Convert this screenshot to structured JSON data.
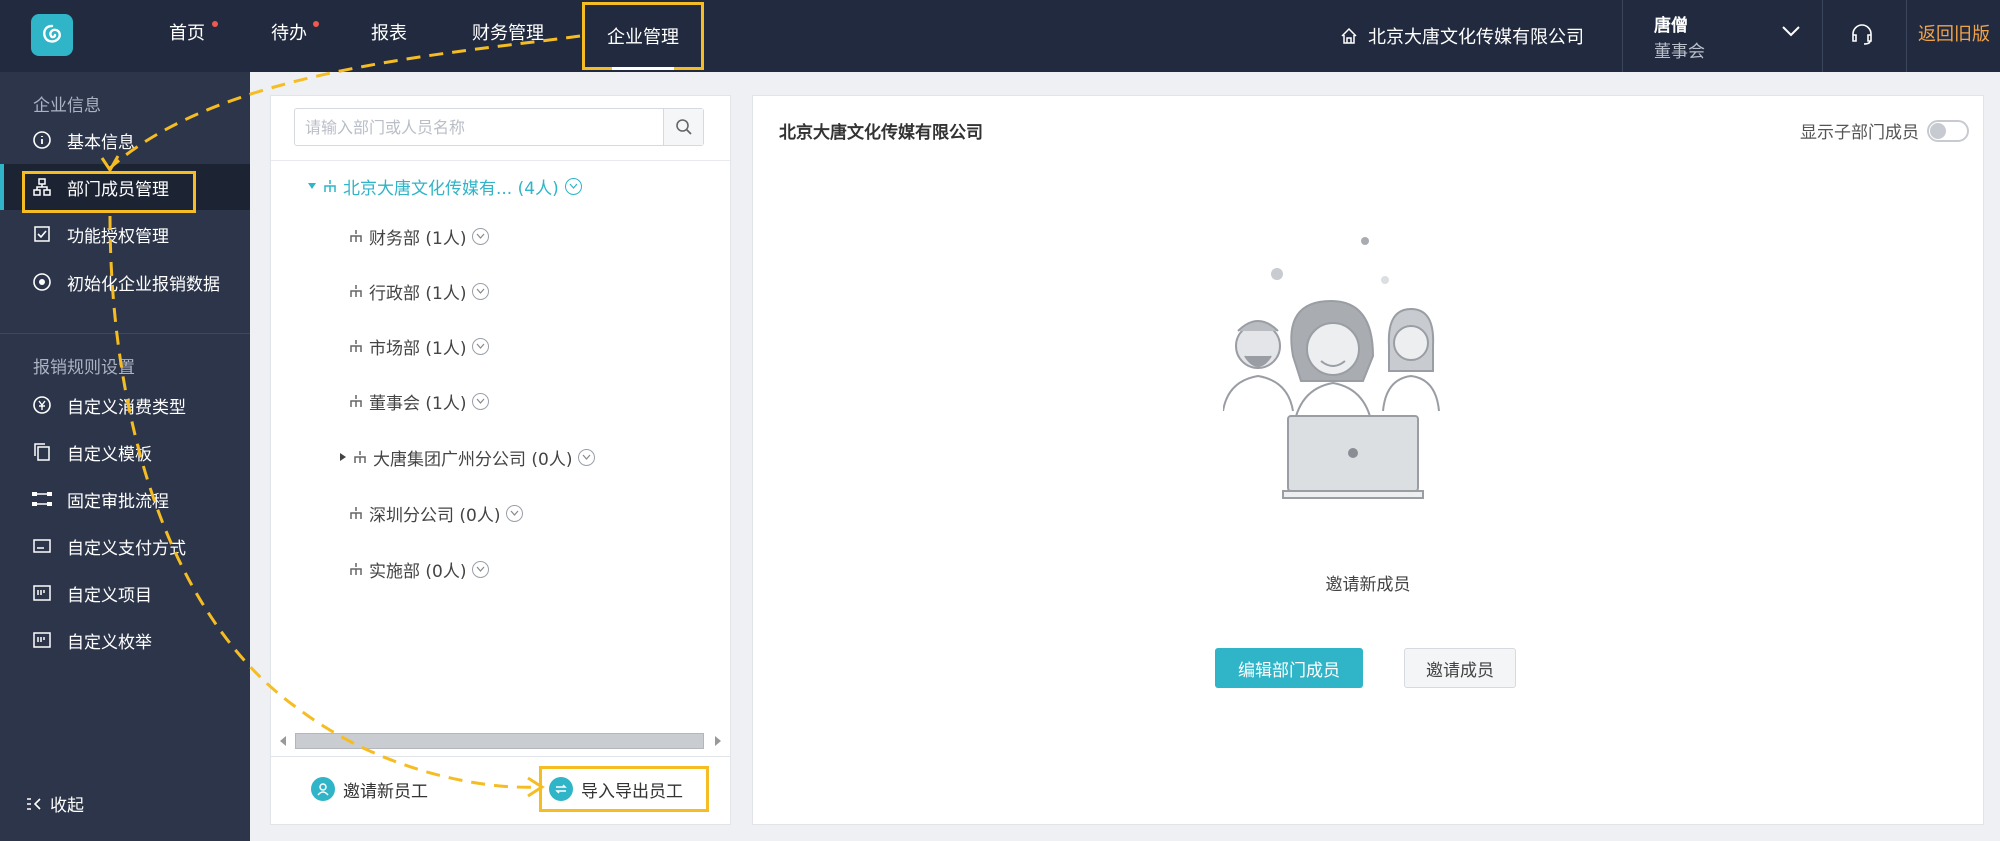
{
  "topbar": {
    "nav": [
      "首页",
      "待办",
      "报表",
      "财务管理",
      "企业管理"
    ],
    "company": "北京大唐文化传媒有限公司",
    "user_name": "唐僧",
    "user_role": "董事会",
    "back_old": "返回旧版"
  },
  "sidebar": {
    "section1": "企业信息",
    "items1": [
      "基本信息",
      "部门成员管理",
      "功能授权管理",
      "初始化企业报销数据"
    ],
    "section2": "报销规则设置",
    "items2": [
      "自定义消费类型",
      "自定义模板",
      "固定审批流程",
      "自定义支付方式",
      "自定义项目",
      "自定义枚举"
    ],
    "collapse": "收起"
  },
  "tree": {
    "search_placeholder": "请输入部门或人员名称",
    "root": "北京大唐文化传媒有...  (4人)",
    "children": [
      "财务部  (1人)",
      "行政部  (1人)",
      "市场部  (1人)",
      "董事会  (1人)",
      "大唐集团广州分公司  (0人)",
      "深圳分公司  (0人)",
      "实施部  (0人)"
    ],
    "invite_new": "邀请新员工",
    "import_export": "导入导出员工"
  },
  "main": {
    "title": "北京大唐文化传媒有限公司",
    "show_sub": "显示子部门成员",
    "empty_text": "邀请新成员",
    "edit_btn": "编辑部门成员",
    "invite_btn": "邀请成员"
  },
  "colors": {
    "accent": "#2fb4c8",
    "highlight": "#f5bd23",
    "topbar": "#212a3e",
    "sidebar": "#2c3549",
    "back_old": "#f1a34a"
  }
}
